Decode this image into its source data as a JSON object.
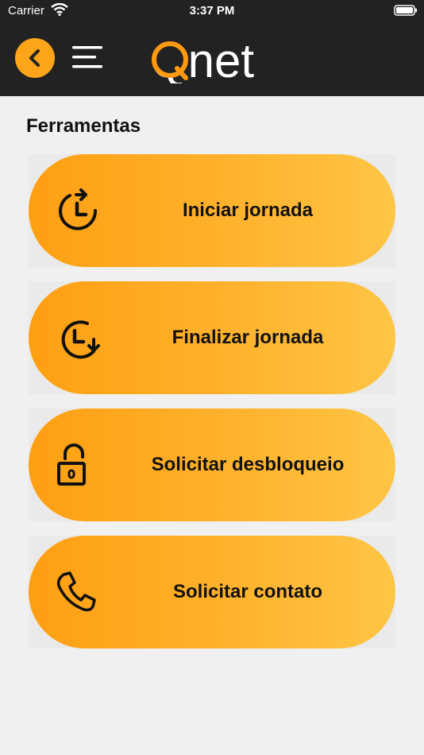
{
  "status_bar": {
    "carrier": "Carrier",
    "time": "3:37 PM"
  },
  "header": {
    "logo_text": "Qnet",
    "back_icon": "chevron-left-icon",
    "menu_icon": "hamburger-menu-icon"
  },
  "colors": {
    "header_bg": "#222222",
    "accent": "#ffa51a",
    "page_bg": "#f0f0f0",
    "card_gradient_start": "#ff9f12",
    "card_gradient_end": "#ffc545"
  },
  "tools": {
    "title": "Ferramentas",
    "items": [
      {
        "label": "Iniciar jornada",
        "icon": "clock-start-icon"
      },
      {
        "label": "Finalizar jornada",
        "icon": "clock-end-icon"
      },
      {
        "label": "Solicitar desbloqueio",
        "icon": "unlock-icon"
      },
      {
        "label": "Solicitar contato",
        "icon": "phone-icon"
      }
    ]
  }
}
